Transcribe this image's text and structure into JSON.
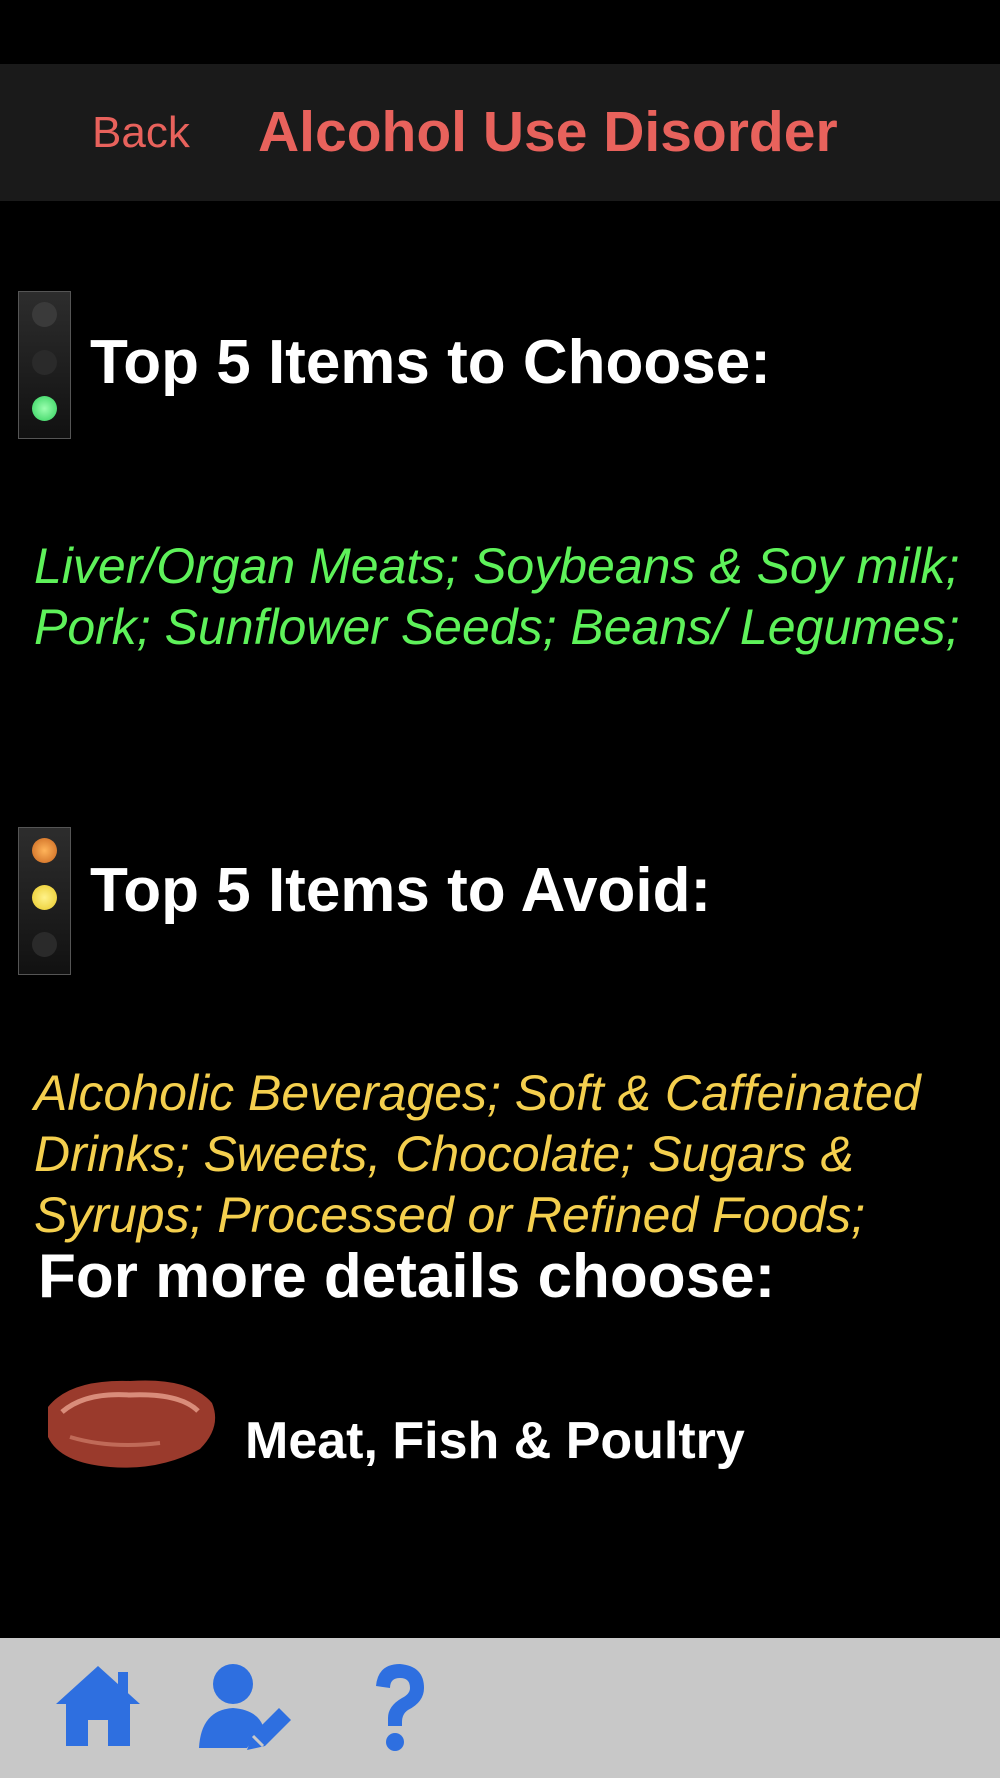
{
  "nav": {
    "back_label": "Back",
    "title": "Alcohol Use Disorder",
    "accent_color": "#e8625c"
  },
  "choose_section": {
    "title": "Top 5 Items to Choose:",
    "icon": "traffic-light-green-icon",
    "items_text": "Liver/Organ Meats; Soybeans & Soy milk; Pork; Sunflower Seeds; Beans/ Legumes;",
    "color": "#5ef25a"
  },
  "avoid_section": {
    "title": "Top 5 Items to Avoid:",
    "icon": "traffic-light-yellow-icon",
    "items_text": "Alcoholic Beverages; Soft & Caffeinated Drinks; Sweets, Chocolate; Sugars & Syrups; Processed or Refined Foods;",
    "color": "#f4cf4e"
  },
  "details": {
    "title": "For more details choose:",
    "categories": [
      {
        "label": "Meat, Fish & Poultry",
        "icon": "meat-steak-icon"
      }
    ]
  },
  "tab_bar": {
    "background": "#c8c8c8",
    "icon_color": "#2e6fe0",
    "items": [
      {
        "icon": "home-icon"
      },
      {
        "icon": "user-edit-icon"
      },
      {
        "icon": "help-icon"
      }
    ]
  }
}
